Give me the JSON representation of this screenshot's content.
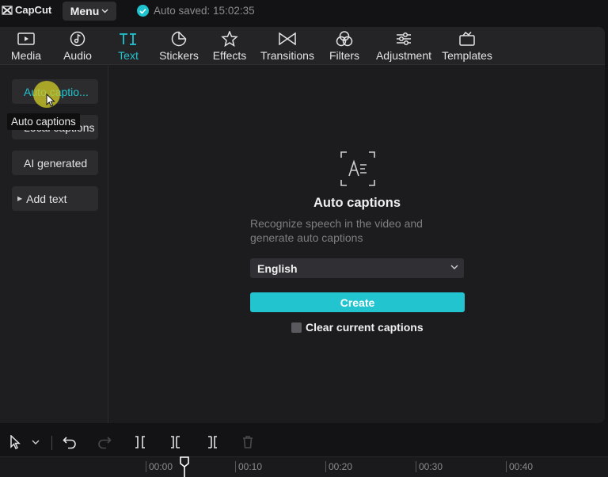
{
  "app": {
    "name": "CapCut",
    "menu_label": "Menu",
    "autosave_text": "Auto saved: 15:02:35"
  },
  "tabs": [
    {
      "label": "Media",
      "icon": "media-icon"
    },
    {
      "label": "Audio",
      "icon": "audio-icon"
    },
    {
      "label": "Text",
      "icon": "text-icon",
      "active": true
    },
    {
      "label": "Stickers",
      "icon": "stickers-icon"
    },
    {
      "label": "Effects",
      "icon": "effects-icon"
    },
    {
      "label": "Transitions",
      "icon": "transitions-icon"
    },
    {
      "label": "Filters",
      "icon": "filters-icon"
    },
    {
      "label": "Adjustment",
      "icon": "adjustment-icon"
    },
    {
      "label": "Templates",
      "icon": "templates-icon"
    }
  ],
  "sidebar": {
    "items": [
      {
        "label": "Auto captio...",
        "active": true
      },
      {
        "label": "Local captions"
      },
      {
        "label": "AI generated"
      },
      {
        "label": "Add text"
      }
    ],
    "tooltip": "Auto captions"
  },
  "captions": {
    "title": "Auto captions",
    "description": "Recognize speech in the video and generate auto captions",
    "language": "English",
    "create_label": "Create",
    "clear_label": "Clear current captions"
  },
  "timeline": {
    "ticks": [
      "00:00",
      "00:10",
      "00:20",
      "00:30",
      "00:40"
    ]
  },
  "colors": {
    "accent": "#22c4cf",
    "background": "#131315",
    "panel": "#1c1c1f"
  }
}
